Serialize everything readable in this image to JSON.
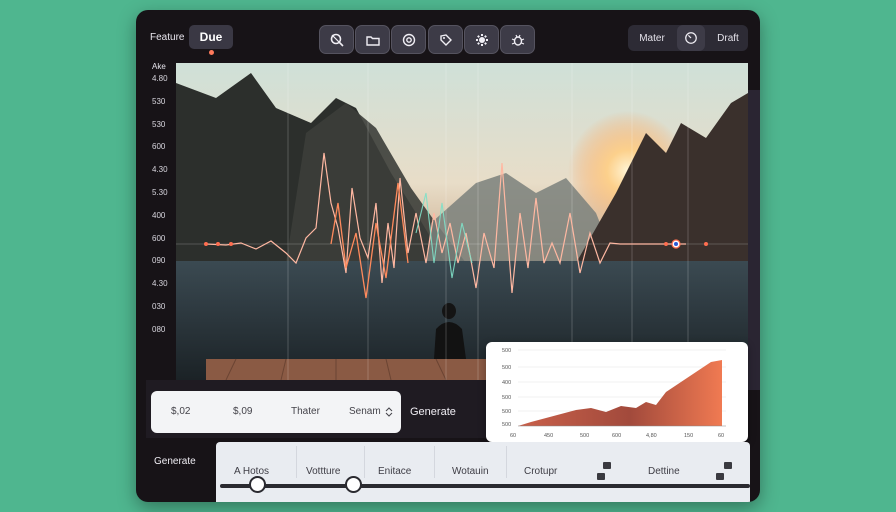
{
  "topbar": {
    "feature_label": "Feature",
    "due_label": "Due",
    "tools": [
      "search-off-icon",
      "folder-icon",
      "target-icon",
      "tag-icon",
      "gear-icon",
      "bug-icon"
    ],
    "mater_label": "Mater",
    "draft_label": "Draft"
  },
  "y_axis": {
    "head": "Ake",
    "ticks": [
      "4.80",
      "530",
      "530",
      "600",
      "4.30",
      "5.30",
      "400",
      "600",
      "090",
      "4.30",
      "030",
      "080"
    ]
  },
  "values": [
    "$,02",
    "$,09",
    "Thater",
    "Senam"
  ],
  "generate_label": "Generate",
  "mini_chart": {
    "y_ticks": [
      "500",
      "500",
      "400",
      "500",
      "500",
      "500"
    ],
    "x_ticks": [
      "60",
      "450",
      "500",
      "600",
      "4,80",
      "150",
      "60"
    ]
  },
  "bottom": {
    "generate_label": "Generate",
    "columns": [
      "A Hotos",
      "Vottture",
      "Enitace",
      "Wotauin",
      "Crotupr",
      "Dettine"
    ],
    "slider_values": [
      0.07,
      0.25
    ]
  },
  "colors": {
    "background": "#4fb68f",
    "accent": "#ff7a5c",
    "frame": "#171317"
  }
}
